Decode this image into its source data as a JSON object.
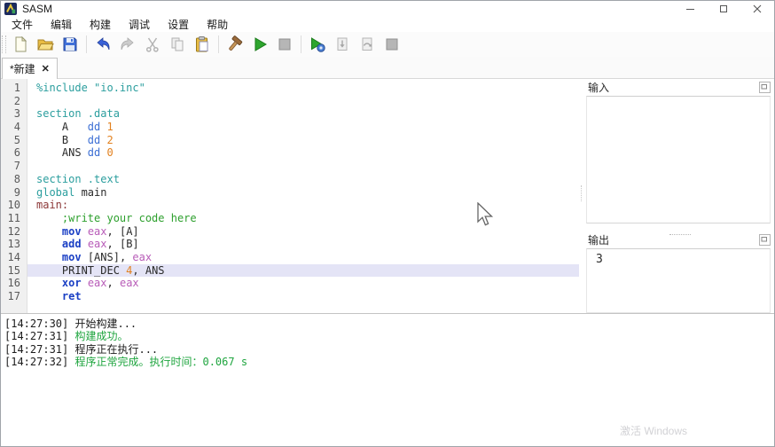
{
  "window": {
    "title": "SASM"
  },
  "menu": {
    "items": [
      "文件",
      "编辑",
      "构建",
      "调试",
      "设置",
      "帮助"
    ]
  },
  "toolbar": {
    "buttons": [
      {
        "name": "new-file-button",
        "icon": "new-file-icon",
        "enabled": true
      },
      {
        "name": "open-file-button",
        "icon": "open-folder-icon",
        "enabled": true
      },
      {
        "name": "save-button",
        "icon": "save-icon",
        "enabled": true
      },
      {
        "name": "undo-button",
        "icon": "undo-icon",
        "enabled": true
      },
      {
        "name": "redo-button",
        "icon": "redo-icon",
        "enabled": false
      },
      {
        "name": "cut-button",
        "icon": "cut-icon",
        "enabled": false
      },
      {
        "name": "copy-button",
        "icon": "copy-icon",
        "enabled": false
      },
      {
        "name": "paste-button",
        "icon": "paste-icon",
        "enabled": true
      },
      {
        "name": "build-button",
        "icon": "build-hammer-icon",
        "enabled": true
      },
      {
        "name": "run-button",
        "icon": "run-icon",
        "enabled": true
      },
      {
        "name": "stop-button",
        "icon": "stop-icon",
        "enabled": false
      },
      {
        "name": "debug-button",
        "icon": "debug-icon",
        "enabled": true
      },
      {
        "name": "step-into-button",
        "icon": "step-into-icon",
        "enabled": false
      },
      {
        "name": "step-over-button",
        "icon": "step-over-icon",
        "enabled": false
      },
      {
        "name": "stop-debug-button",
        "icon": "stop-debug-icon",
        "enabled": false
      }
    ],
    "separators_after": [
      2,
      7,
      10
    ]
  },
  "tab": {
    "label": "*新建",
    "close": "✕"
  },
  "editor": {
    "lines": [
      {
        "n": 1,
        "hl": false,
        "segs": [
          {
            "t": "%include ",
            "c": "dir"
          },
          {
            "t": "\"io.inc\"",
            "c": "str"
          }
        ]
      },
      {
        "n": 2,
        "hl": false,
        "segs": []
      },
      {
        "n": 3,
        "hl": false,
        "segs": [
          {
            "t": "section .data",
            "c": "dir"
          }
        ]
      },
      {
        "n": 4,
        "hl": false,
        "segs": [
          {
            "t": "    A   ",
            "c": "plain"
          },
          {
            "t": "dd ",
            "c": "kw2"
          },
          {
            "t": "1",
            "c": "num"
          }
        ]
      },
      {
        "n": 5,
        "hl": false,
        "segs": [
          {
            "t": "    B   ",
            "c": "plain"
          },
          {
            "t": "dd ",
            "c": "kw2"
          },
          {
            "t": "2",
            "c": "num"
          }
        ]
      },
      {
        "n": 6,
        "hl": false,
        "segs": [
          {
            "t": "    ANS ",
            "c": "plain"
          },
          {
            "t": "dd ",
            "c": "kw2"
          },
          {
            "t": "0",
            "c": "num"
          }
        ]
      },
      {
        "n": 7,
        "hl": false,
        "segs": []
      },
      {
        "n": 8,
        "hl": false,
        "segs": [
          {
            "t": "section .text",
            "c": "dir"
          }
        ]
      },
      {
        "n": 9,
        "hl": false,
        "segs": [
          {
            "t": "global ",
            "c": "dir"
          },
          {
            "t": "main",
            "c": "plain"
          }
        ]
      },
      {
        "n": 10,
        "hl": false,
        "segs": [
          {
            "t": "main:",
            "c": "label"
          }
        ]
      },
      {
        "n": 11,
        "hl": false,
        "segs": [
          {
            "t": "    ",
            "c": "plain"
          },
          {
            "t": ";write your code here",
            "c": "comment"
          }
        ]
      },
      {
        "n": 12,
        "hl": false,
        "segs": [
          {
            "t": "    ",
            "c": "plain"
          },
          {
            "t": "mov",
            "c": "kw"
          },
          {
            "t": " ",
            "c": "plain"
          },
          {
            "t": "eax",
            "c": "reg"
          },
          {
            "t": ", [A]",
            "c": "plain"
          }
        ]
      },
      {
        "n": 13,
        "hl": false,
        "segs": [
          {
            "t": "    ",
            "c": "plain"
          },
          {
            "t": "add",
            "c": "kw"
          },
          {
            "t": " ",
            "c": "plain"
          },
          {
            "t": "eax",
            "c": "reg"
          },
          {
            "t": ", [B]",
            "c": "plain"
          }
        ]
      },
      {
        "n": 14,
        "hl": false,
        "segs": [
          {
            "t": "    ",
            "c": "plain"
          },
          {
            "t": "mov",
            "c": "kw"
          },
          {
            "t": " [ANS], ",
            "c": "plain"
          },
          {
            "t": "eax",
            "c": "reg"
          }
        ]
      },
      {
        "n": 15,
        "hl": true,
        "segs": [
          {
            "t": "    PRINT_DEC ",
            "c": "plain"
          },
          {
            "t": "4",
            "c": "num"
          },
          {
            "t": ", ANS",
            "c": "plain"
          }
        ]
      },
      {
        "n": 16,
        "hl": false,
        "segs": [
          {
            "t": "    ",
            "c": "plain"
          },
          {
            "t": "xor",
            "c": "kw"
          },
          {
            "t": " ",
            "c": "plain"
          },
          {
            "t": "eax",
            "c": "reg"
          },
          {
            "t": ", ",
            "c": "plain"
          },
          {
            "t": "eax",
            "c": "reg"
          }
        ]
      },
      {
        "n": 17,
        "hl": false,
        "segs": [
          {
            "t": "    ",
            "c": "plain"
          },
          {
            "t": "ret",
            "c": "kw"
          }
        ]
      }
    ]
  },
  "input_panel": {
    "title": "输入"
  },
  "output_panel": {
    "title": "输出",
    "value": "3"
  },
  "log": {
    "lines": [
      {
        "time": "[14:27:30]",
        "text": "开始构建...",
        "color": "black"
      },
      {
        "time": "[14:27:31]",
        "text": "构建成功。",
        "color": "green"
      },
      {
        "time": "[14:27:31]",
        "text": "程序正在执行...",
        "color": "black"
      },
      {
        "time": "[14:27:32]",
        "text": "程序正常完成。执行时间：0.067 s",
        "color": "green"
      }
    ]
  },
  "watermark": "激活 Windows",
  "colors": {
    "directive": "#2b9e9e",
    "keyword": "#1a3fc4",
    "register": "#b85cb8",
    "number": "#e2801e",
    "comment": "#2ea02e",
    "label": "#8c3838",
    "line_highlight": "#e4e4f6",
    "log_success": "#1fa53f"
  }
}
